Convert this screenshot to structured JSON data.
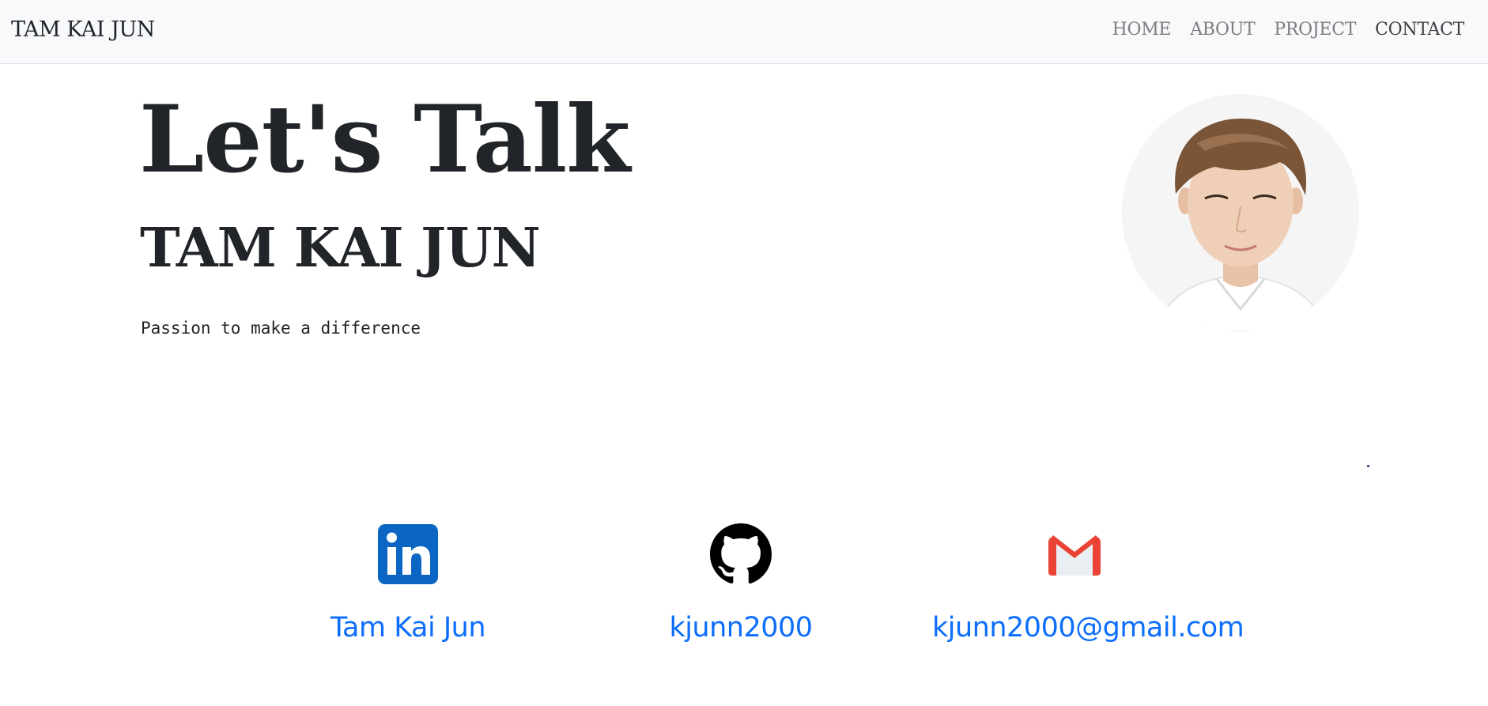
{
  "navbar": {
    "brand": "TAM KAI JUN",
    "links": [
      {
        "label": "HOME"
      },
      {
        "label": "ABOUT"
      },
      {
        "label": "PROJECT"
      },
      {
        "label": "CONTACT",
        "active": true
      }
    ]
  },
  "hero": {
    "title": "Let's Talk",
    "name": "TAM KAI JUN",
    "tagline": "Passion to make a difference"
  },
  "contacts": [
    {
      "icon": "linkedin-icon",
      "label": "Tam Kai Jun"
    },
    {
      "icon": "github-icon",
      "label": "kjunn2000"
    },
    {
      "icon": "gmail-icon",
      "label": "kjunn2000@gmail.com"
    }
  ],
  "colors": {
    "link": "#0d6efd",
    "navbar_bg": "#f8f9fa",
    "text": "#212529",
    "linkedin": "#0a66c2",
    "gmail_red": "#ea4335"
  }
}
